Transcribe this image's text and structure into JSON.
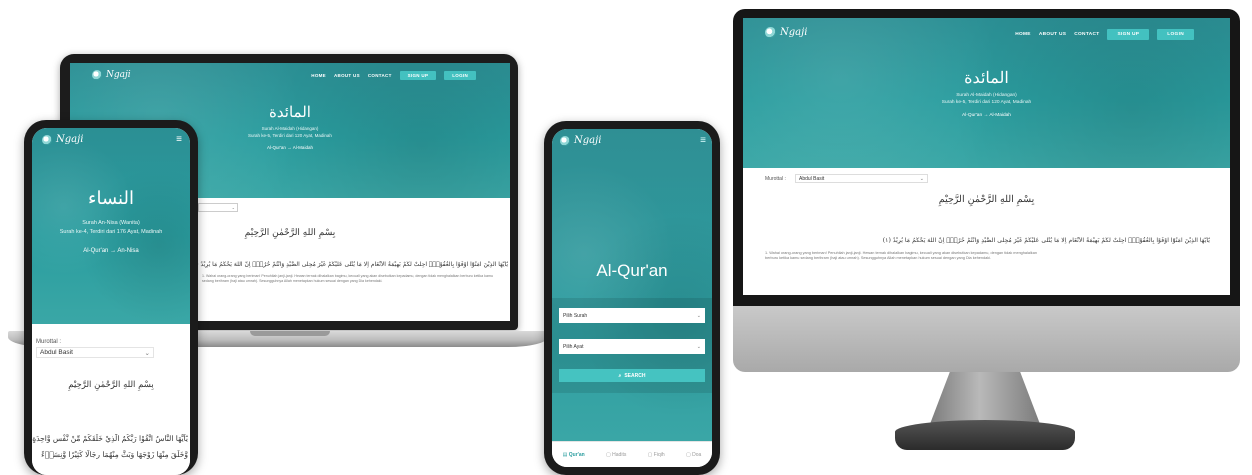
{
  "site": {
    "logo_text": "Ngaji",
    "nav": [
      "HOME",
      "ABOUT US",
      "CONTACT"
    ],
    "signup_label": "SIGN UP",
    "login_label": "LOGIN"
  },
  "maidah": {
    "arabic_title": "المائدة",
    "line1": "Surah Al-Maidah (Hidangan)",
    "line2": "Surah ke-5, Terdiri dari 120 Ayat, Madinah",
    "crumb_home": "Al-Qur'an",
    "crumb_arrow": "→",
    "crumb_current": "Al-Maidah",
    "murottal_label": "Murottal :",
    "reciter": "Abdul Basit",
    "bismillah": "بِسْمِ اللهِ الرَّحْمٰنِ الرَّحِيْمِ",
    "ayah1_arabic": "يٰٓاَيُّهَا الَّذِيْنَ اٰمَنُوْٓا اَوْفُوْا بِالْعُقُوْدِۗ اُحِلَّتْ لَكُمْ بَهِيْمَةُ الْاَنْعَامِ اِلَّا مَا يُتْلٰى عَلَيْكُمْ غَيْرَ مُحِلِّى الصَّيْدِ وَاَنْتُمْ حُرُمٌۗ اِنَّ اللّٰهَ يَحْكُمُ مَا يُرِيْدُ (١)",
    "ayah1_translation": "1. Wahai orang-orang yang beriman! Penuhilah janji-janji. Hewan ternak dihalalkan bagimu, kecuali yang akan disebutkan kepadamu, dengan tidak menghalalkan berburu ketika kamu sedang berihram (haji atau umrah). Sesungguhnya Allah menetapkan hukum sesuai dengan yang Dia kehendaki."
  },
  "nisa": {
    "arabic_title": "النساء",
    "line1": "Surah An-Nisa (Wanita)",
    "line2": "Surah ke-4, Terdiri dari 176 Ayat, Madinah",
    "crumb_home": "Al-Qur'an",
    "crumb_arrow": "→",
    "crumb_current": "An-Nisa",
    "murottal_label": "Murottal :",
    "reciter": "Abdul Basit",
    "bismillah": "بِسْمِ اللهِ الرَّحْمٰنِ الرَّحِيْمِ",
    "ayah1_line1": "يٰٓاَيُّهَا النَّاسُ اتَّقُوْا رَبَّكُمُ الَّذِيْ خَلَقَكُمْ مِّنْ نَّفْسٍ وَّاحِدَةٍ",
    "ayah1_line2": "وَّخَلَقَ مِنْهَا زَوْجَهَا وَبَثَّ مِنْهُمَا رِجَالًا كَثِيْرًا وَّنِسَاۤءً"
  },
  "quran_search": {
    "title": "Al-Qur'an",
    "surah_placeholder": "Pilih Surah",
    "ayat_placeholder": "Pilih Ayat",
    "search_label": "SEARCH",
    "tabs": [
      "Qur'an",
      "Hadits",
      "Fiqih",
      "Doa"
    ]
  },
  "colors": {
    "primary": "#2a9d9f",
    "accent": "#43c1c0"
  }
}
